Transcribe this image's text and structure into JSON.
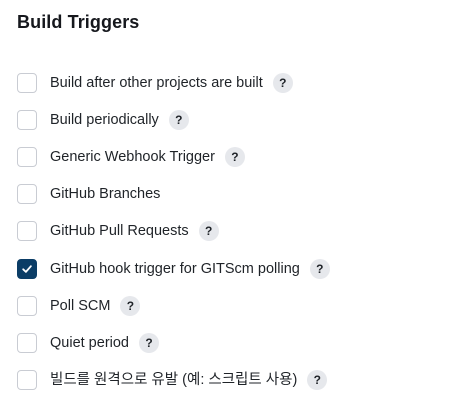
{
  "section": {
    "title": "Build Triggers"
  },
  "triggers": [
    {
      "label": "Build after other projects are built",
      "checked": false,
      "help": "?"
    },
    {
      "label": "Build periodically",
      "checked": false,
      "help": "?"
    },
    {
      "label": "Generic Webhook Trigger",
      "checked": false,
      "help": "?"
    },
    {
      "label": "GitHub Branches",
      "checked": false,
      "help": ""
    },
    {
      "label": "GitHub Pull Requests",
      "checked": false,
      "help": "?"
    },
    {
      "label": "GitHub hook trigger for GITScm polling",
      "checked": true,
      "help": "?"
    },
    {
      "label": "Poll SCM",
      "checked": false,
      "help": "?"
    },
    {
      "label": "Quiet period",
      "checked": false,
      "help": "?"
    },
    {
      "label": "빌드를 원격으로 유발 (예: 스크립트 사용)",
      "checked": false,
      "help": "?"
    }
  ],
  "colors": {
    "checked_fill": "#0b3d66",
    "checkbox_border": "#c9ccd3",
    "help_background": "#e6e8ec"
  },
  "icons": {
    "checkmark": "checkmark-icon",
    "help": "help-icon"
  }
}
